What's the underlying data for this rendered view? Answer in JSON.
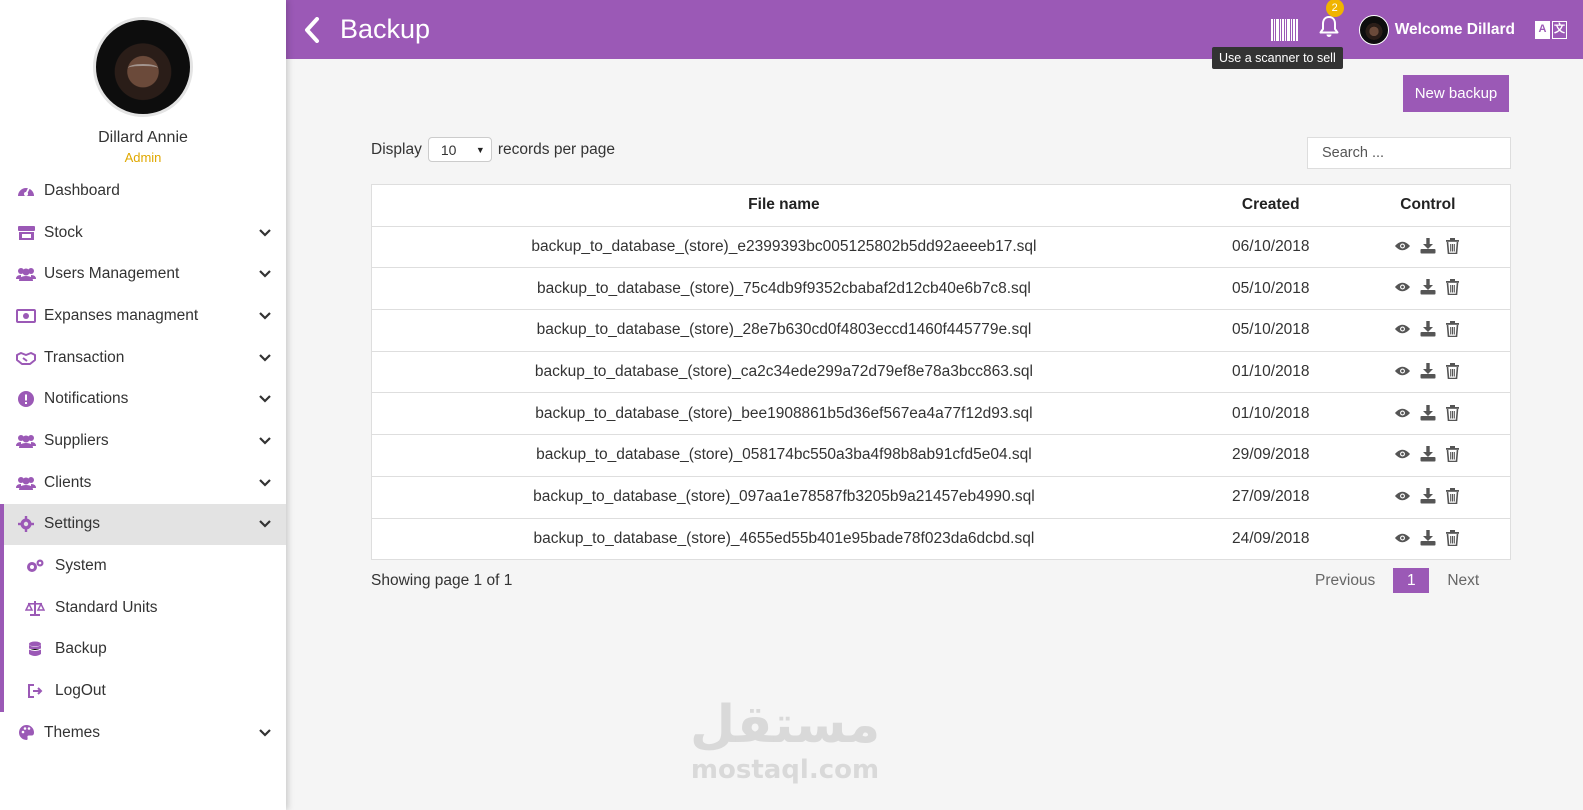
{
  "profile": {
    "name": "Dillard Annie",
    "role": "Admin"
  },
  "sidebar": {
    "items": [
      {
        "label": "Dashboard",
        "icon": "dashboard-icon",
        "has_arrow": false
      },
      {
        "label": "Stock",
        "icon": "store-icon",
        "has_arrow": true
      },
      {
        "label": "Users Management",
        "icon": "users-icon",
        "has_arrow": true
      },
      {
        "label": "Expanses managment",
        "icon": "money-bill-icon",
        "has_arrow": true
      },
      {
        "label": "Transaction",
        "icon": "handshake-icon",
        "has_arrow": true
      },
      {
        "label": "Notifications",
        "icon": "exclamation-circle-icon",
        "has_arrow": true
      },
      {
        "label": "Suppliers",
        "icon": "users-icon",
        "has_arrow": true
      },
      {
        "label": "Clients",
        "icon": "users-icon",
        "has_arrow": true
      },
      {
        "label": "Settings",
        "icon": "gear-icon",
        "has_arrow": true,
        "active": true
      }
    ],
    "settings_sub": [
      {
        "label": "System",
        "icon": "cogs-icon"
      },
      {
        "label": "Standard Units",
        "icon": "balance-scale-icon"
      },
      {
        "label": "Backup",
        "icon": "database-icon"
      },
      {
        "label": "LogOut",
        "icon": "sign-out-icon"
      }
    ],
    "themes": {
      "label": "Themes",
      "icon": "palette-icon"
    }
  },
  "header": {
    "title": "Backup",
    "notification_count": "2",
    "welcome": "Welcome Dillard",
    "scanner_tooltip": "Use a scanner to sell",
    "lang_a": "A",
    "lang_b": "文"
  },
  "toolbar": {
    "new_backup_label": "New backup",
    "display_label": "Display",
    "per_page_value": "10",
    "per_page_suffix": "records per page",
    "search_placeholder": "Search ..."
  },
  "table": {
    "columns": [
      "File name",
      "Created",
      "Control"
    ],
    "rows": [
      {
        "file": "backup_to_database_(store)_e2399393bc005125802b5dd92aeeeb17.sql",
        "created": "06/10/2018"
      },
      {
        "file": "backup_to_database_(store)_75c4db9f9352cbabaf2d12cb40e6b7c8.sql",
        "created": "05/10/2018"
      },
      {
        "file": "backup_to_database_(store)_28e7b630cd0f4803eccd1460f445779e.sql",
        "created": "05/10/2018"
      },
      {
        "file": "backup_to_database_(store)_ca2c34ede299a72d79ef8e78a3bcc863.sql",
        "created": "01/10/2018"
      },
      {
        "file": "backup_to_database_(store)_bee1908861b5d36ef567ea4a77f12d93.sql",
        "created": "01/10/2018"
      },
      {
        "file": "backup_to_database_(store)_058174bc550a3ba4f98b8ab91cfd5e04.sql",
        "created": "29/09/2018"
      },
      {
        "file": "backup_to_database_(store)_097aa1e78587fb3205b9a21457eb4990.sql",
        "created": "27/09/2018"
      },
      {
        "file": "backup_to_database_(store)_4655ed55b401e95bade78f023da6dcbd.sql",
        "created": "24/09/2018"
      }
    ]
  },
  "pagination": {
    "info": "Showing page 1 of 1",
    "previous": "Previous",
    "current": "1",
    "next": "Next"
  },
  "watermark": {
    "arabic": "مستقل",
    "latin": "mostaql.com"
  },
  "colors": {
    "accent": "#9b59b6",
    "badge": "#f0b400",
    "role": "#e0a800"
  }
}
